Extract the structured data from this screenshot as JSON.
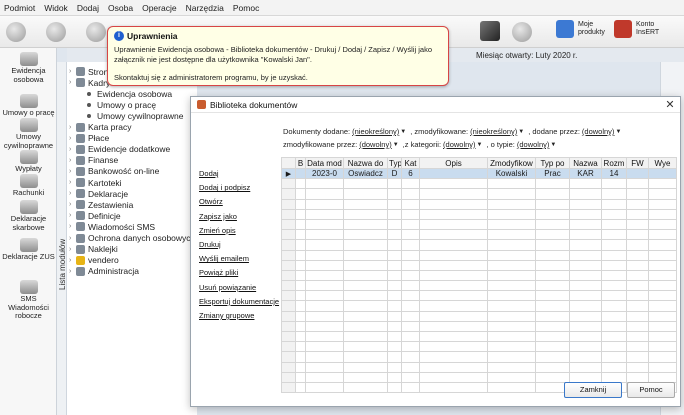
{
  "menu": [
    "Podmiot",
    "Widok",
    "Dodaj",
    "Osoba",
    "Operacje",
    "Narzędzia",
    "Pomoc"
  ],
  "toolbar": {
    "moje_produkty": "Moje produkty",
    "konto": "Konto InsERT"
  },
  "left_panel": [
    {
      "icon": "people-icon",
      "label": "Ewidencja osobowa"
    },
    {
      "icon": "contract-icon",
      "label": "Umowy o pracę"
    },
    {
      "icon": "contract-civil-icon",
      "label": "Umowy cywilnoprawne"
    },
    {
      "icon": "payout-icon",
      "label": "Wypłaty"
    },
    {
      "icon": "bills-icon",
      "label": "Rachunki"
    },
    {
      "icon": "tax-icon",
      "label": "Deklaracje skarbowe"
    },
    {
      "icon": "zus-icon",
      "label": "Deklaracje ZUS"
    },
    {
      "icon": "sms-icon",
      "label": "SMS Wiadomości robocze"
    }
  ],
  "side_strip_label": "Lista modułów",
  "header": {
    "miesiac": "Miesiąc otwarty: Luty 2020 r."
  },
  "tree": [
    {
      "label": "Strona",
      "type": "node"
    },
    {
      "label": "Kadry",
      "type": "node"
    },
    {
      "label": "Ewidencja osobowa",
      "type": "leaf"
    },
    {
      "label": "Umowy o pracę",
      "type": "leaf"
    },
    {
      "label": "Umowy cywilnoprawne",
      "type": "leaf"
    },
    {
      "label": "Karta pracy",
      "type": "node"
    },
    {
      "label": "Płace",
      "type": "node"
    },
    {
      "label": "Ewidencje dodatkowe",
      "type": "node"
    },
    {
      "label": "Finanse",
      "type": "node"
    },
    {
      "label": "Bankowość on-line",
      "type": "node"
    },
    {
      "label": "Kartoteki",
      "type": "node"
    },
    {
      "label": "Deklaracje",
      "type": "node"
    },
    {
      "label": "Zestawienia",
      "type": "node"
    },
    {
      "label": "Definicje",
      "type": "node"
    },
    {
      "label": "Wiadomości SMS",
      "type": "node"
    },
    {
      "label": "Ochrona danych osobowych",
      "type": "node"
    },
    {
      "label": "Naklejki",
      "type": "node"
    },
    {
      "label": "vendero",
      "type": "node"
    },
    {
      "label": "Administracja",
      "type": "node"
    }
  ],
  "tooltip": {
    "title": "Uprawnienia",
    "message": "Uprawnienie Ewidencja osobowa - Biblioteka dokumentów - Drukuj / Dodaj / Zapisz / Wyślij jako załącznik nie jest dostępne dla użytkownika \"Kowalski Jan\".",
    "message2": "Skontaktuj się z administratorem programu, by je uzyskać."
  },
  "dialog": {
    "title": "Biblioteka dokumentów",
    "filters": {
      "dodane_label": "Dokumenty dodane:",
      "dodane_value": "(nieokreślony)",
      "zmodyfikowane_label": ", zmodyfikowane:",
      "zmodyfikowane_value": "(nieokreślony)",
      "dodane_przez_label": ", dodane przez:",
      "dodane_przez_value": "(dowolny)",
      "zmod_przez_label": "zmodyfikowane przez:",
      "zmod_przez_value": "(dowolny)",
      "kategorii_label": ",z kategorii:",
      "kategorii_value": "(dowolny)",
      "typie_label": ", o typie:",
      "typie_value": "(dowolny)"
    },
    "actions": [
      "Dodaj",
      "Dodaj i podpisz",
      "Otwórz",
      "Zapisz jako",
      "Zmień opis",
      "Drukuj",
      "Wyślij emailem",
      "Powiąż pliki",
      "Usuń powiązanie",
      "Eksportuj dokumentacje",
      "Zmiany grupowe"
    ],
    "columns": [
      "",
      "B",
      "Data mod",
      "Nazwa do",
      "Typ",
      "Kat",
      "Opis",
      "Zmodyfikow",
      "Typ po",
      "Nazwa",
      "Rozm",
      "FW",
      "Wye"
    ],
    "rows": [
      [
        "▶",
        "",
        "2023-0",
        "Oswiadcz",
        "D",
        "6",
        "",
        "Kowalski",
        "Prac",
        "KAR",
        "14",
        "",
        ""
      ]
    ],
    "empty_rows": 21,
    "buttons": {
      "close": "Zamknij",
      "help": "Pomoc"
    }
  }
}
